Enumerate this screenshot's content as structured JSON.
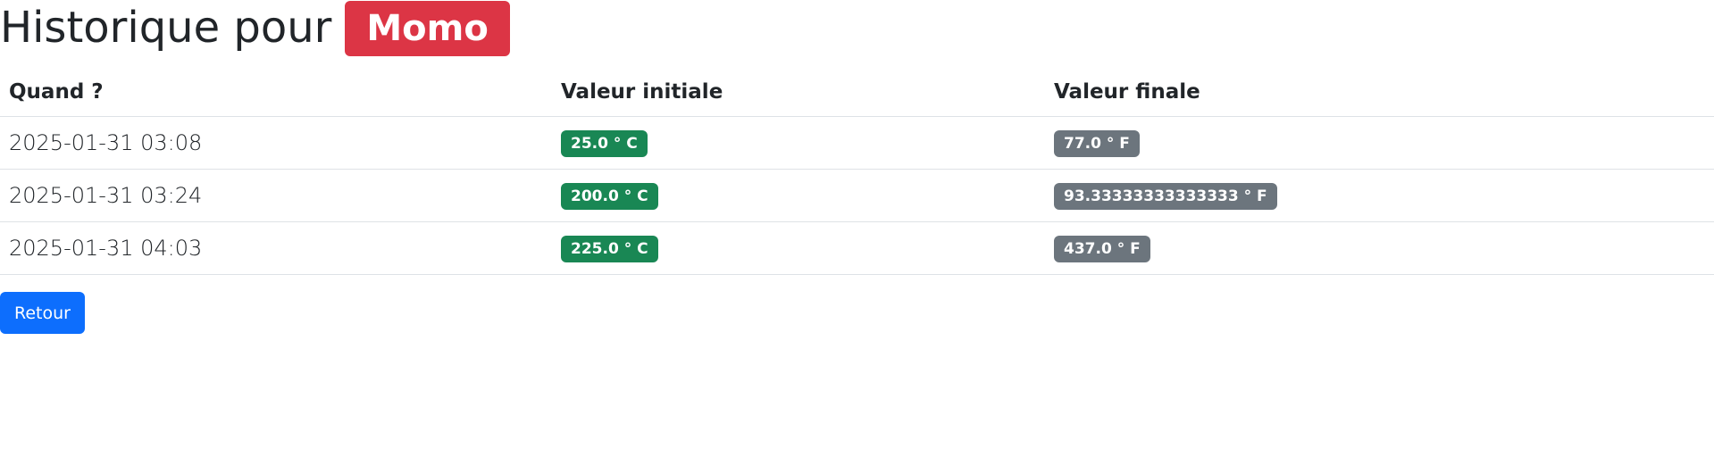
{
  "header": {
    "title_prefix": "Historique pour",
    "name_badge": "Momo"
  },
  "table": {
    "columns": [
      "Quand ?",
      "Valeur initiale",
      "Valeur finale"
    ],
    "rows": [
      {
        "when": "2025-01-31 03:08",
        "initial": "25.0 ° C",
        "final": "77.0 ° F"
      },
      {
        "when": "2025-01-31 03:24",
        "initial": "200.0 ° C",
        "final": "93.33333333333333 ° F"
      },
      {
        "when": "2025-01-31 04:03",
        "initial": "225.0 ° C",
        "final": "437.0 ° F"
      }
    ]
  },
  "actions": {
    "back_label": "Retour"
  },
  "colors": {
    "name_badge": "#dc3545",
    "initial_badge": "#198754",
    "final_badge": "#6c757d",
    "primary_button": "#0d6efd"
  }
}
